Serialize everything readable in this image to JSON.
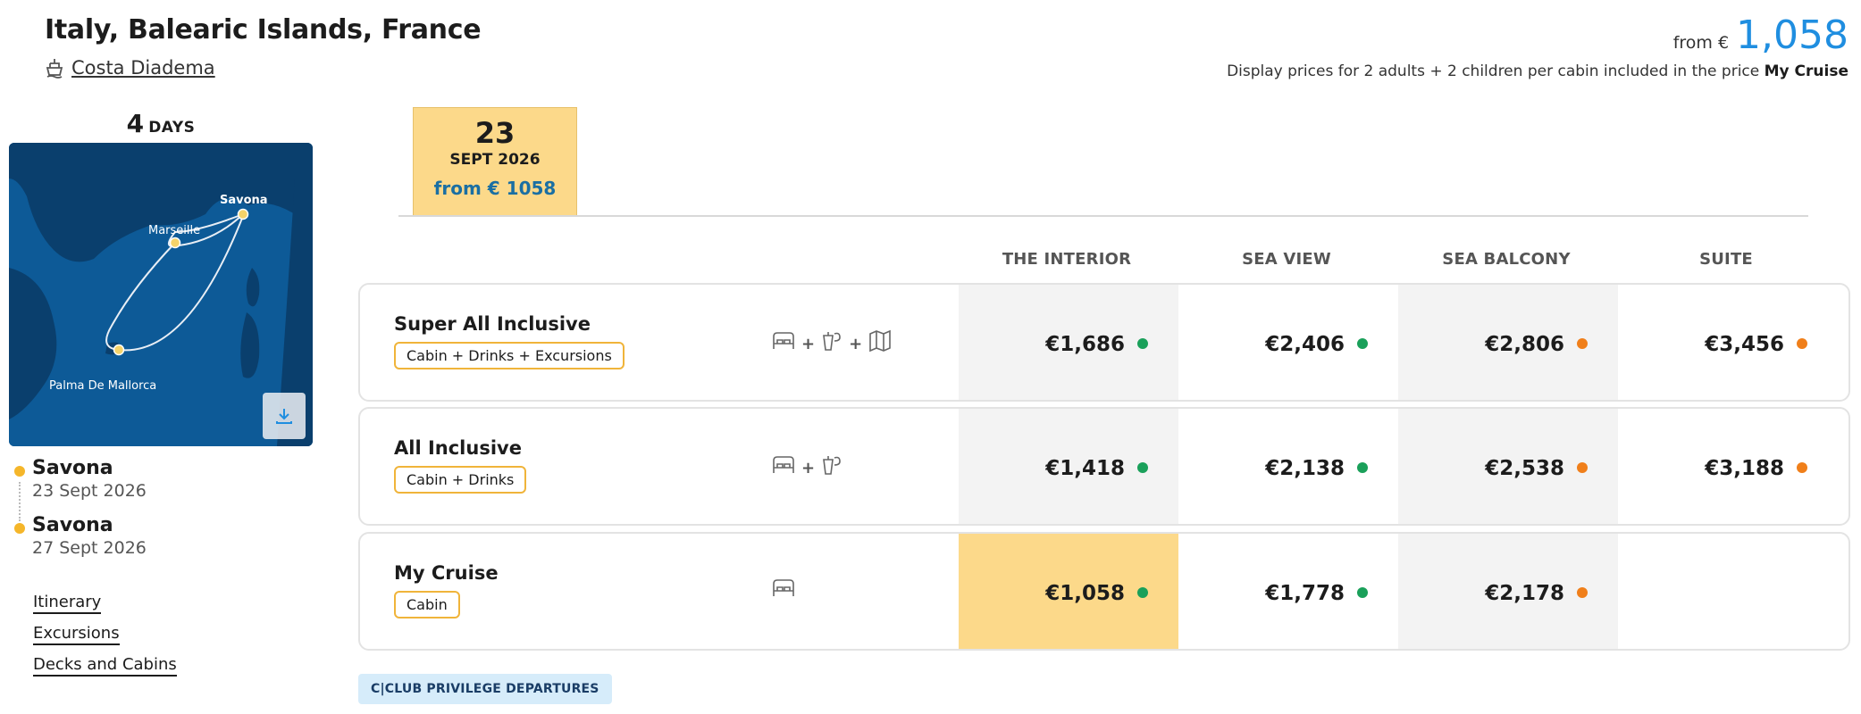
{
  "header": {
    "title": "Italy, Balearic Islands, France",
    "ship_name": "Costa Diadema",
    "price_from_label": "from €",
    "price_from_value": "1,058",
    "price_note": "Display prices for 2 adults + 2 children per cabin included in the price",
    "price_note_bold": "My Cruise"
  },
  "duration": {
    "number": "4",
    "unit": "DAYS"
  },
  "map": {
    "labels": {
      "savona": "Savona",
      "marseille": "Marseille",
      "palma": "Palma De Mallorca"
    }
  },
  "ports": [
    {
      "name": "Savona",
      "date": "23 Sept 2026"
    },
    {
      "name": "Savona",
      "date": "27 Sept 2026"
    }
  ],
  "links": [
    "Itinerary",
    "Excursions",
    "Decks and Cabins"
  ],
  "date_tab": {
    "day": "23",
    "month": "SEPT 2026",
    "price": "from € 1058"
  },
  "columns": [
    "THE INTERIOR",
    "SEA VIEW",
    "SEA BALCONY",
    "SUITE"
  ],
  "packages": [
    {
      "name": "Super All Inclusive",
      "tag": "Cabin + Drinks + Excursions",
      "prices": [
        "€1,686",
        "€2,406",
        "€2,806",
        "€3,456"
      ],
      "status": [
        "green",
        "green",
        "orange",
        "orange"
      ]
    },
    {
      "name": "All Inclusive",
      "tag": "Cabin + Drinks",
      "prices": [
        "€1,418",
        "€2,138",
        "€2,538",
        "€3,188"
      ],
      "status": [
        "green",
        "green",
        "orange",
        "orange"
      ]
    },
    {
      "name": "My Cruise",
      "tag": "Cabin",
      "prices": [
        "€1,058",
        "€1,778",
        "€2,178",
        ""
      ],
      "status": [
        "green",
        "green",
        "orange",
        ""
      ]
    }
  ],
  "cclub_badge": "C|CLUB PRIVILEGE DEPARTURES",
  "colors": {
    "accent_blue": "#1f8ee0",
    "highlight_yellow": "#fcd98a",
    "tag_border": "#f0b43a",
    "status_green": "#1aa05a",
    "status_orange": "#f07f1a"
  }
}
